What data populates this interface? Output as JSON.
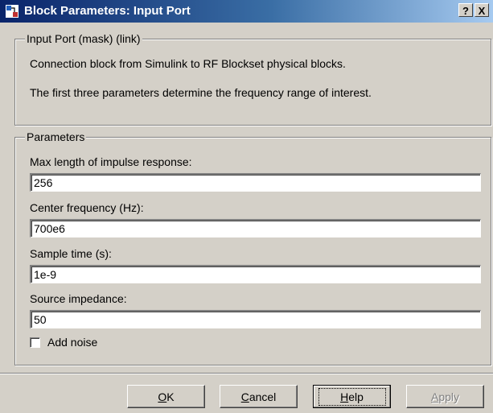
{
  "window": {
    "title": "Block Parameters: Input Port",
    "help_button": "?",
    "close_button": "X"
  },
  "description": {
    "group_label": "Input Port (mask) (link)",
    "line1": "Connection block from Simulink to RF Blockset physical blocks.",
    "line2": "The first three parameters determine the frequency range of interest."
  },
  "parameters": {
    "group_label": "Parameters",
    "max_length_label": "Max length of impulse response:",
    "max_length_value": "256",
    "center_freq_label": "Center frequency (Hz):",
    "center_freq_value": "700e6",
    "sample_time_label": "Sample time (s):",
    "sample_time_value": "1e-9",
    "source_impedance_label": "Source impedance:",
    "source_impedance_value": "50",
    "add_noise_label": "Add noise",
    "add_noise_checked": false
  },
  "buttons": {
    "ok": {
      "first": "O",
      "rest": "K"
    },
    "cancel": {
      "first": "C",
      "rest": "ancel"
    },
    "help": {
      "first": "H",
      "rest": "elp"
    },
    "apply": {
      "first": "A",
      "rest": "pply"
    }
  }
}
